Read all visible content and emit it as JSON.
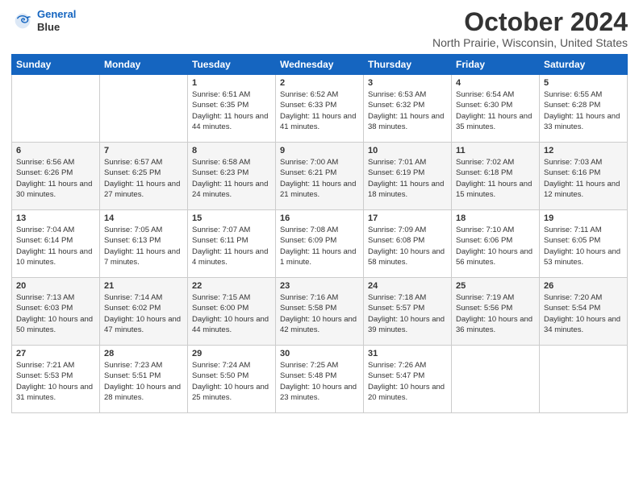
{
  "header": {
    "logo_line1": "General",
    "logo_line2": "Blue",
    "title": "October 2024",
    "location": "North Prairie, Wisconsin, United States"
  },
  "weekdays": [
    "Sunday",
    "Monday",
    "Tuesday",
    "Wednesday",
    "Thursday",
    "Friday",
    "Saturday"
  ],
  "weeks": [
    [
      {
        "day": "",
        "info": ""
      },
      {
        "day": "",
        "info": ""
      },
      {
        "day": "1",
        "info": "Sunrise: 6:51 AM\nSunset: 6:35 PM\nDaylight: 11 hours and 44 minutes."
      },
      {
        "day": "2",
        "info": "Sunrise: 6:52 AM\nSunset: 6:33 PM\nDaylight: 11 hours and 41 minutes."
      },
      {
        "day": "3",
        "info": "Sunrise: 6:53 AM\nSunset: 6:32 PM\nDaylight: 11 hours and 38 minutes."
      },
      {
        "day": "4",
        "info": "Sunrise: 6:54 AM\nSunset: 6:30 PM\nDaylight: 11 hours and 35 minutes."
      },
      {
        "day": "5",
        "info": "Sunrise: 6:55 AM\nSunset: 6:28 PM\nDaylight: 11 hours and 33 minutes."
      }
    ],
    [
      {
        "day": "6",
        "info": "Sunrise: 6:56 AM\nSunset: 6:26 PM\nDaylight: 11 hours and 30 minutes."
      },
      {
        "day": "7",
        "info": "Sunrise: 6:57 AM\nSunset: 6:25 PM\nDaylight: 11 hours and 27 minutes."
      },
      {
        "day": "8",
        "info": "Sunrise: 6:58 AM\nSunset: 6:23 PM\nDaylight: 11 hours and 24 minutes."
      },
      {
        "day": "9",
        "info": "Sunrise: 7:00 AM\nSunset: 6:21 PM\nDaylight: 11 hours and 21 minutes."
      },
      {
        "day": "10",
        "info": "Sunrise: 7:01 AM\nSunset: 6:19 PM\nDaylight: 11 hours and 18 minutes."
      },
      {
        "day": "11",
        "info": "Sunrise: 7:02 AM\nSunset: 6:18 PM\nDaylight: 11 hours and 15 minutes."
      },
      {
        "day": "12",
        "info": "Sunrise: 7:03 AM\nSunset: 6:16 PM\nDaylight: 11 hours and 12 minutes."
      }
    ],
    [
      {
        "day": "13",
        "info": "Sunrise: 7:04 AM\nSunset: 6:14 PM\nDaylight: 11 hours and 10 minutes."
      },
      {
        "day": "14",
        "info": "Sunrise: 7:05 AM\nSunset: 6:13 PM\nDaylight: 11 hours and 7 minutes."
      },
      {
        "day": "15",
        "info": "Sunrise: 7:07 AM\nSunset: 6:11 PM\nDaylight: 11 hours and 4 minutes."
      },
      {
        "day": "16",
        "info": "Sunrise: 7:08 AM\nSunset: 6:09 PM\nDaylight: 11 hours and 1 minute."
      },
      {
        "day": "17",
        "info": "Sunrise: 7:09 AM\nSunset: 6:08 PM\nDaylight: 10 hours and 58 minutes."
      },
      {
        "day": "18",
        "info": "Sunrise: 7:10 AM\nSunset: 6:06 PM\nDaylight: 10 hours and 56 minutes."
      },
      {
        "day": "19",
        "info": "Sunrise: 7:11 AM\nSunset: 6:05 PM\nDaylight: 10 hours and 53 minutes."
      }
    ],
    [
      {
        "day": "20",
        "info": "Sunrise: 7:13 AM\nSunset: 6:03 PM\nDaylight: 10 hours and 50 minutes."
      },
      {
        "day": "21",
        "info": "Sunrise: 7:14 AM\nSunset: 6:02 PM\nDaylight: 10 hours and 47 minutes."
      },
      {
        "day": "22",
        "info": "Sunrise: 7:15 AM\nSunset: 6:00 PM\nDaylight: 10 hours and 44 minutes."
      },
      {
        "day": "23",
        "info": "Sunrise: 7:16 AM\nSunset: 5:58 PM\nDaylight: 10 hours and 42 minutes."
      },
      {
        "day": "24",
        "info": "Sunrise: 7:18 AM\nSunset: 5:57 PM\nDaylight: 10 hours and 39 minutes."
      },
      {
        "day": "25",
        "info": "Sunrise: 7:19 AM\nSunset: 5:56 PM\nDaylight: 10 hours and 36 minutes."
      },
      {
        "day": "26",
        "info": "Sunrise: 7:20 AM\nSunset: 5:54 PM\nDaylight: 10 hours and 34 minutes."
      }
    ],
    [
      {
        "day": "27",
        "info": "Sunrise: 7:21 AM\nSunset: 5:53 PM\nDaylight: 10 hours and 31 minutes."
      },
      {
        "day": "28",
        "info": "Sunrise: 7:23 AM\nSunset: 5:51 PM\nDaylight: 10 hours and 28 minutes."
      },
      {
        "day": "29",
        "info": "Sunrise: 7:24 AM\nSunset: 5:50 PM\nDaylight: 10 hours and 25 minutes."
      },
      {
        "day": "30",
        "info": "Sunrise: 7:25 AM\nSunset: 5:48 PM\nDaylight: 10 hours and 23 minutes."
      },
      {
        "day": "31",
        "info": "Sunrise: 7:26 AM\nSunset: 5:47 PM\nDaylight: 10 hours and 20 minutes."
      },
      {
        "day": "",
        "info": ""
      },
      {
        "day": "",
        "info": ""
      }
    ]
  ]
}
